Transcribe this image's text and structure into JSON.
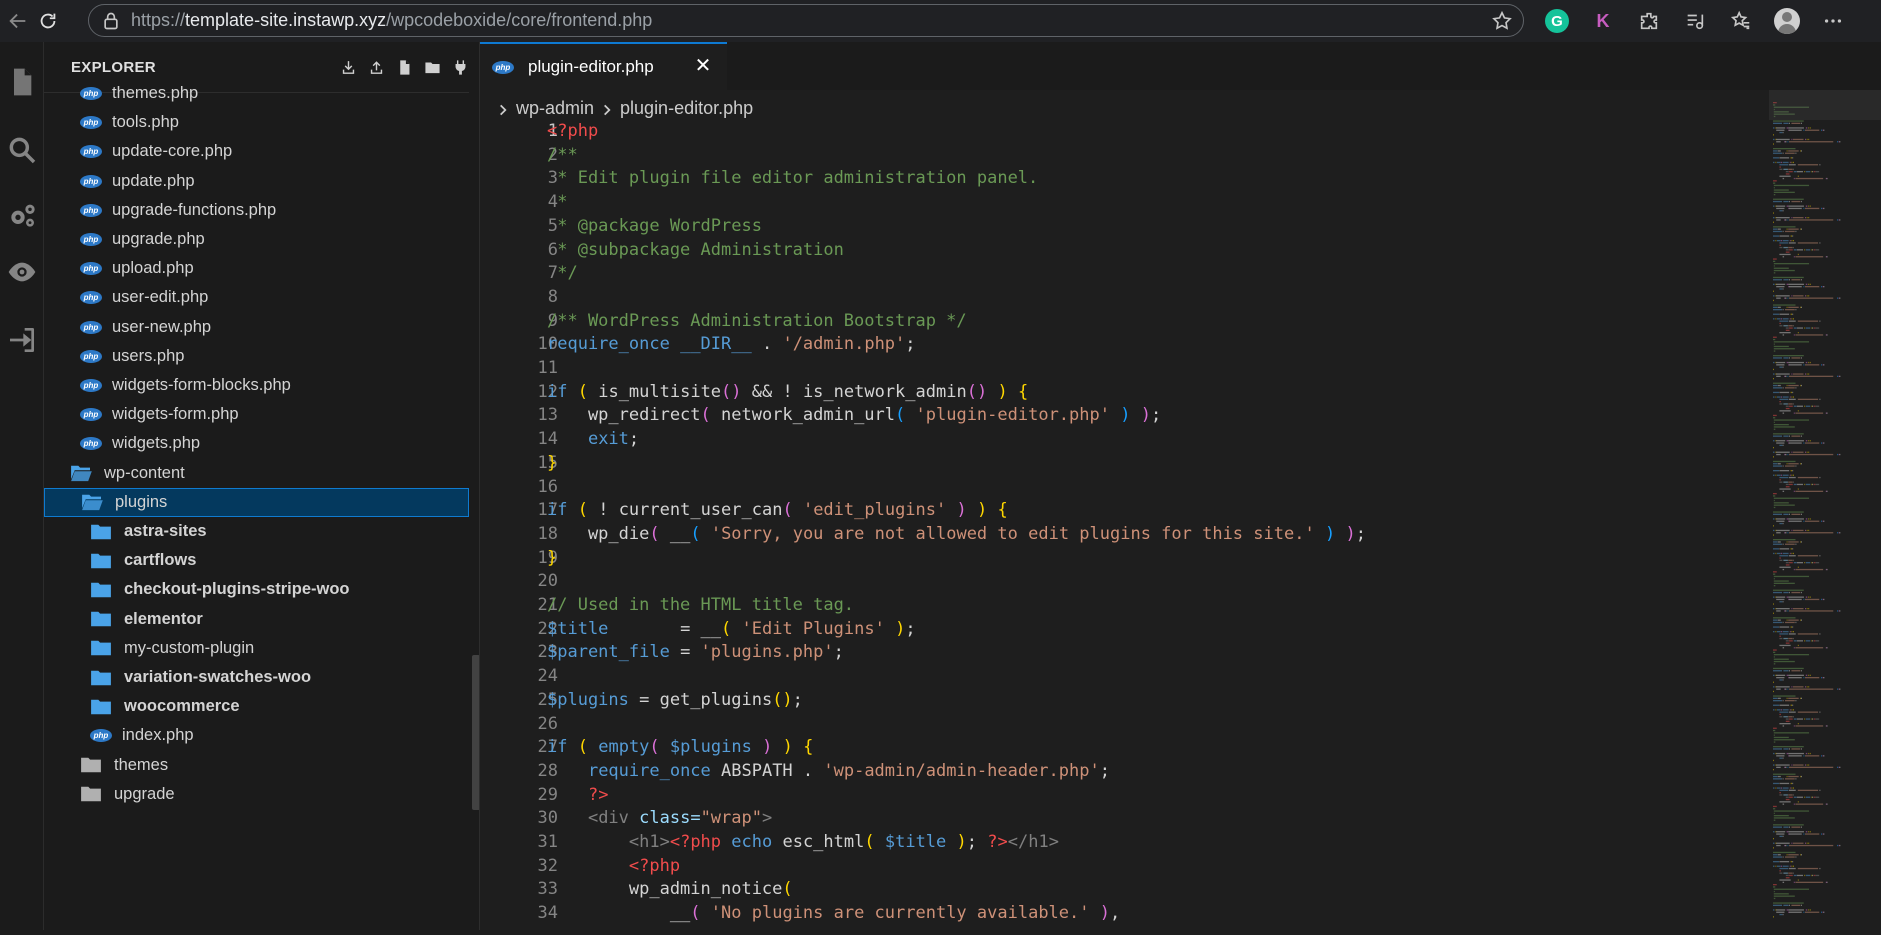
{
  "browser": {
    "url_scheme": "https://",
    "url_host": "template-site.instawp.xyz",
    "url_path": "/wpcodeboxide/core/frontend.php",
    "grammarly_letter": "G",
    "k_ext_letter": "K"
  },
  "explorer": {
    "title": "EXPLORER",
    "rows": [
      {
        "label": "themes.php",
        "type": "php",
        "indent": 1,
        "bold": false
      },
      {
        "label": "tools.php",
        "type": "php",
        "indent": 1,
        "bold": false
      },
      {
        "label": "update-core.php",
        "type": "php",
        "indent": 1,
        "bold": false
      },
      {
        "label": "update.php",
        "type": "php",
        "indent": 1,
        "bold": false
      },
      {
        "label": "upgrade-functions.php",
        "type": "php",
        "indent": 1,
        "bold": false
      },
      {
        "label": "upgrade.php",
        "type": "php",
        "indent": 1,
        "bold": false
      },
      {
        "label": "upload.php",
        "type": "php",
        "indent": 1,
        "bold": false
      },
      {
        "label": "user-edit.php",
        "type": "php",
        "indent": 1,
        "bold": false
      },
      {
        "label": "user-new.php",
        "type": "php",
        "indent": 1,
        "bold": false
      },
      {
        "label": "users.php",
        "type": "php",
        "indent": 1,
        "bold": false
      },
      {
        "label": "widgets-form-blocks.php",
        "type": "php",
        "indent": 1,
        "bold": false
      },
      {
        "label": "widgets-form.php",
        "type": "php",
        "indent": 1,
        "bold": false
      },
      {
        "label": "widgets.php",
        "type": "php",
        "indent": 1,
        "bold": false
      },
      {
        "label": "wp-content",
        "type": "folder-open",
        "indent": 0,
        "bold": false
      },
      {
        "label": "plugins",
        "type": "folder-open",
        "indent": 1,
        "bold": false,
        "selected": true
      },
      {
        "label": "astra-sites",
        "type": "folder",
        "indent": 2,
        "bold": true
      },
      {
        "label": "cartflows",
        "type": "folder",
        "indent": 2,
        "bold": true
      },
      {
        "label": "checkout-plugins-stripe-woo",
        "type": "folder",
        "indent": 2,
        "bold": true
      },
      {
        "label": "elementor",
        "type": "folder",
        "indent": 2,
        "bold": true
      },
      {
        "label": "my-custom-plugin",
        "type": "folder",
        "indent": 2,
        "bold": false
      },
      {
        "label": "variation-swatches-woo",
        "type": "folder",
        "indent": 2,
        "bold": true
      },
      {
        "label": "woocommerce",
        "type": "folder",
        "indent": 2,
        "bold": true
      },
      {
        "label": "index.php",
        "type": "php",
        "indent": 2,
        "bold": false
      },
      {
        "label": "themes",
        "type": "folder-grey",
        "indent": 1,
        "bold": false
      },
      {
        "label": "upgrade",
        "type": "folder-grey",
        "indent": 1,
        "bold": false
      }
    ]
  },
  "editor": {
    "tab_label": "plugin-editor.php",
    "tab_close": "✕",
    "breadcrumb": [
      "wp-admin",
      "plugin-editor.php"
    ],
    "active_line": 1,
    "lines": [
      [
        [
          "<?php",
          "tag"
        ]
      ],
      [
        [
          "/**",
          "cm"
        ]
      ],
      [
        [
          " * Edit plugin file editor administration panel.",
          "cm"
        ]
      ],
      [
        [
          " *",
          "cm"
        ]
      ],
      [
        [
          " * @package WordPress",
          "cm"
        ]
      ],
      [
        [
          " * @subpackage Administration",
          "cm"
        ]
      ],
      [
        [
          " */",
          "cm"
        ]
      ],
      [],
      [
        [
          "/** WordPress Administration Bootstrap */",
          "cm"
        ]
      ],
      [
        [
          "require_once",
          "kw"
        ],
        [
          " ",
          ""
        ],
        [
          "__DIR__",
          "kw"
        ],
        [
          " . ",
          ""
        ],
        [
          "'/admin.php'",
          "str"
        ],
        [
          ";",
          ""
        ]
      ],
      [],
      [
        [
          "if",
          "kw"
        ],
        [
          " ",
          ""
        ],
        [
          "(",
          "p1"
        ],
        [
          " is_multisite",
          ""
        ],
        [
          "()",
          "p2"
        ],
        [
          " && ! is_network_admin",
          ""
        ],
        [
          "()",
          "p2"
        ],
        [
          " ",
          ""
        ],
        [
          ")",
          "p1"
        ],
        [
          " ",
          ""
        ],
        [
          "{",
          "p1"
        ]
      ],
      [
        [
          "    wp_redirect",
          ""
        ],
        [
          "(",
          "p2"
        ],
        [
          " network_admin_url",
          ""
        ],
        [
          "(",
          "p3"
        ],
        [
          " ",
          ""
        ],
        [
          "'plugin-editor.php'",
          "str"
        ],
        [
          " ",
          ""
        ],
        [
          ")",
          "p3"
        ],
        [
          " ",
          ""
        ],
        [
          ")",
          "p2"
        ],
        [
          ";",
          ""
        ]
      ],
      [
        [
          "    ",
          ""
        ],
        [
          "exit",
          "kw"
        ],
        [
          ";",
          ""
        ]
      ],
      [
        [
          "}",
          "p1"
        ]
      ],
      [],
      [
        [
          "if",
          "kw"
        ],
        [
          " ",
          ""
        ],
        [
          "(",
          "p1"
        ],
        [
          " ! current_user_can",
          ""
        ],
        [
          "(",
          "p2"
        ],
        [
          " ",
          ""
        ],
        [
          "'edit_plugins'",
          "str"
        ],
        [
          " ",
          ""
        ],
        [
          ")",
          "p2"
        ],
        [
          " ",
          ""
        ],
        [
          ")",
          "p1"
        ],
        [
          " ",
          ""
        ],
        [
          "{",
          "p1"
        ]
      ],
      [
        [
          "    wp_die",
          ""
        ],
        [
          "(",
          "p2"
        ],
        [
          " __",
          ""
        ],
        [
          "(",
          "p3"
        ],
        [
          " ",
          ""
        ],
        [
          "'Sorry, you are not allowed to edit plugins for this site.'",
          "str"
        ],
        [
          " ",
          ""
        ],
        [
          ")",
          "p3"
        ],
        [
          " ",
          ""
        ],
        [
          ")",
          "p2"
        ],
        [
          ";",
          ""
        ]
      ],
      [
        [
          "}",
          "p1"
        ]
      ],
      [],
      [
        [
          "// Used in the HTML title tag.",
          "cm"
        ]
      ],
      [
        [
          "$title",
          "kw"
        ],
        [
          "       = __",
          ""
        ],
        [
          "(",
          "p1"
        ],
        [
          " ",
          ""
        ],
        [
          "'Edit Plugins'",
          "str"
        ],
        [
          " ",
          ""
        ],
        [
          ")",
          "p1"
        ],
        [
          ";",
          ""
        ]
      ],
      [
        [
          "$parent_file",
          "kw"
        ],
        [
          " = ",
          ""
        ],
        [
          "'plugins.php'",
          "str"
        ],
        [
          ";",
          ""
        ]
      ],
      [],
      [
        [
          "$plugins",
          "kw"
        ],
        [
          " = get_plugins",
          ""
        ],
        [
          "()",
          "p1"
        ],
        [
          ";",
          ""
        ]
      ],
      [],
      [
        [
          "if",
          "kw"
        ],
        [
          " ",
          ""
        ],
        [
          "(",
          "p1"
        ],
        [
          " ",
          ""
        ],
        [
          "empty",
          "kw"
        ],
        [
          "(",
          "p2"
        ],
        [
          " ",
          ""
        ],
        [
          "$plugins",
          "kw"
        ],
        [
          " ",
          ""
        ],
        [
          ")",
          "p2"
        ],
        [
          " ",
          ""
        ],
        [
          ")",
          "p1"
        ],
        [
          " ",
          ""
        ],
        [
          "{",
          "p1"
        ]
      ],
      [
        [
          "    ",
          ""
        ],
        [
          "require_once",
          "kw"
        ],
        [
          " ABSPATH . ",
          ""
        ],
        [
          "'wp-admin/admin-header.php'",
          "str"
        ],
        [
          ";",
          ""
        ]
      ],
      [
        [
          "    ",
          ""
        ],
        [
          "?>",
          "tag"
        ]
      ],
      [
        [
          "    ",
          ""
        ],
        [
          "<div ",
          "html"
        ],
        [
          "class=",
          "attr"
        ],
        [
          "\"wrap\"",
          "str"
        ],
        [
          ">",
          "html"
        ]
      ],
      [
        [
          "        ",
          ""
        ],
        [
          "<h1>",
          "html"
        ],
        [
          "<?php",
          "tag"
        ],
        [
          " ",
          ""
        ],
        [
          "echo",
          "kw"
        ],
        [
          " esc_html",
          ""
        ],
        [
          "(",
          "p1"
        ],
        [
          " ",
          ""
        ],
        [
          "$title",
          "kw"
        ],
        [
          " ",
          ""
        ],
        [
          ")",
          "p1"
        ],
        [
          "; ",
          ""
        ],
        [
          "?>",
          "tag"
        ],
        [
          "</h1>",
          "html"
        ]
      ],
      [
        [
          "        ",
          ""
        ],
        [
          "<?php",
          "tag"
        ]
      ],
      [
        [
          "        wp_admin_notice",
          ""
        ],
        [
          "(",
          "p1"
        ]
      ],
      [
        [
          "            __",
          ""
        ],
        [
          "(",
          "p2"
        ],
        [
          " ",
          ""
        ],
        [
          "'No plugins are currently available.'",
          "str"
        ],
        [
          " ",
          ""
        ],
        [
          ")",
          "p2"
        ],
        [
          ",",
          ""
        ]
      ]
    ]
  },
  "colors": {
    "tag": "#f14c4c",
    "cm": "#6a9955",
    "kw": "#569cd6",
    "str": "#ce9178",
    "p1": "#ffd700",
    "p2": "#da70d6",
    "p3": "#179fff",
    "html": "#808080",
    "attr": "#9cdcfe",
    "default": "#d4d4d4"
  }
}
